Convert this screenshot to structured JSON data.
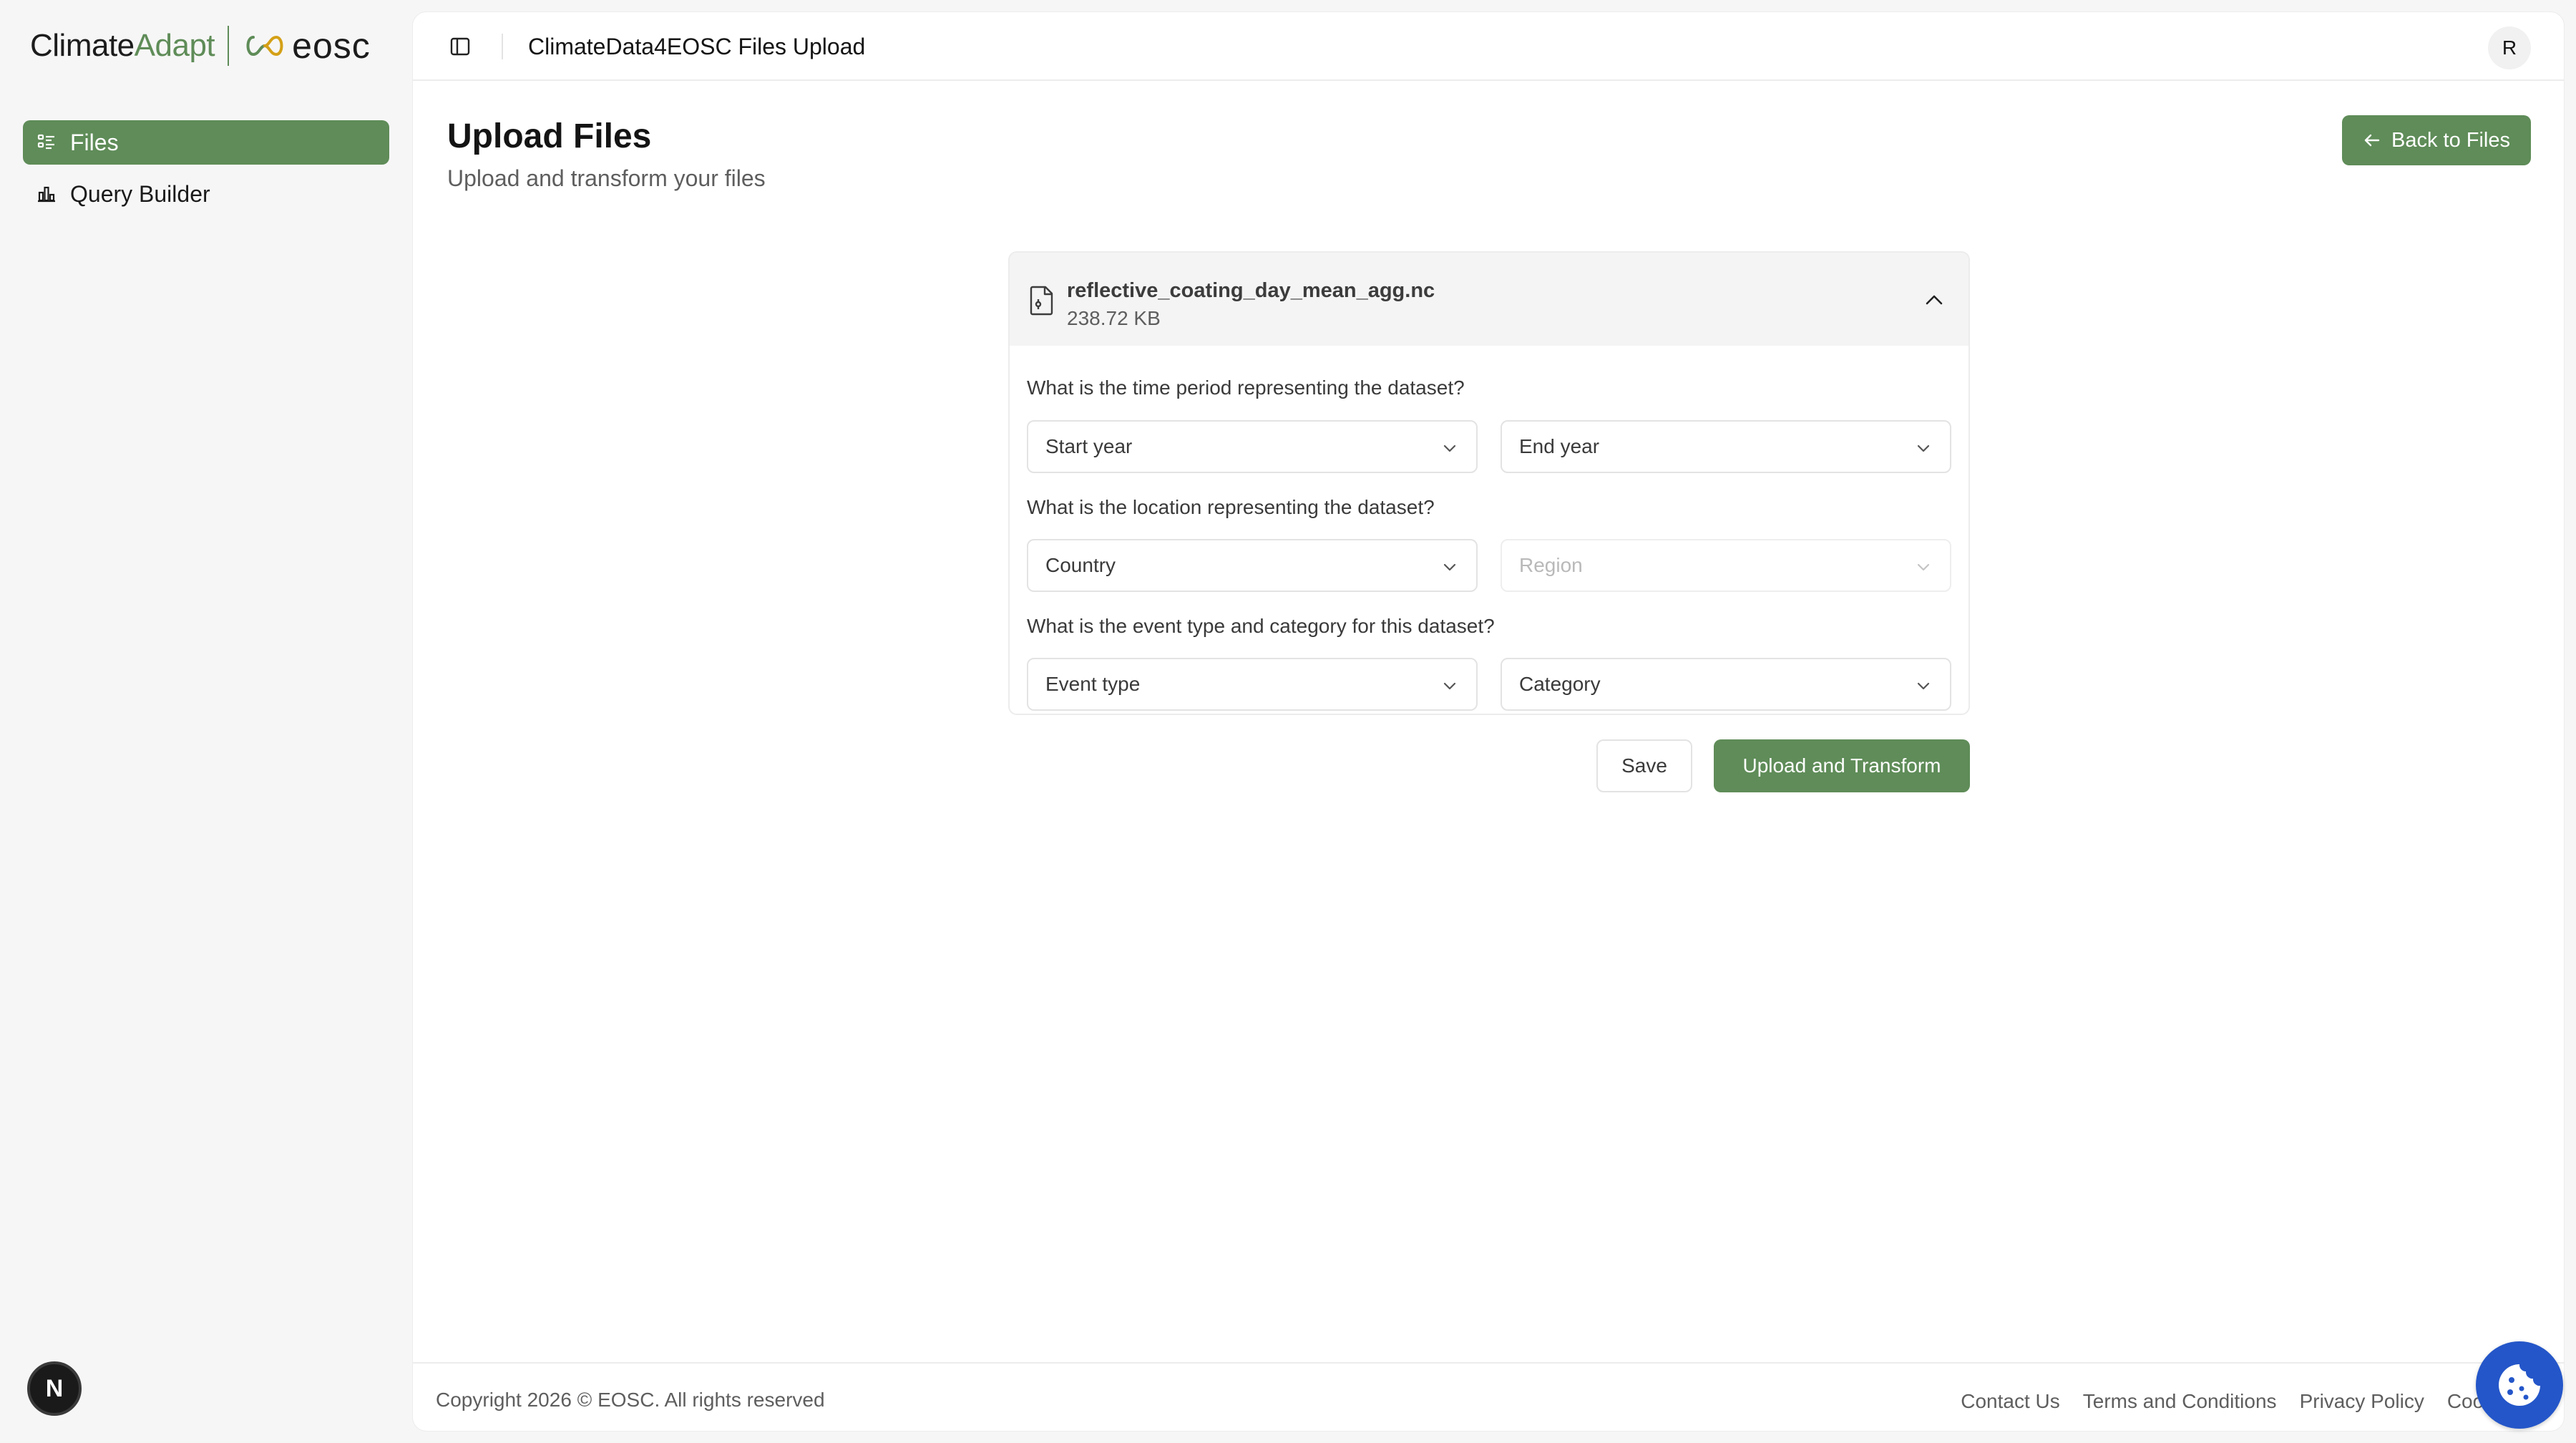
{
  "brand": {
    "climate": "Climate",
    "adapt": "Adapt",
    "eosc": "eosc"
  },
  "sidebar": {
    "items": [
      {
        "label": "Files",
        "icon": "list-icon",
        "active": true
      },
      {
        "label": "Query Builder",
        "icon": "chart-icon",
        "active": false
      }
    ]
  },
  "topbar": {
    "title": "ClimateData4EOSC Files Upload",
    "user_initial": "R"
  },
  "page": {
    "title": "Upload Files",
    "subtitle": "Upload and transform your files",
    "back_label": "Back to Files"
  },
  "file": {
    "name": "reflective_coating_day_mean_agg.nc",
    "size": "238.72 KB"
  },
  "form": {
    "q_time": "What is the time period representing the dataset?",
    "start_year": "Start year",
    "end_year": "End year",
    "q_location": "What is the location representing the dataset?",
    "country": "Country",
    "region": "Region",
    "q_event": "What is the event type and category for this dataset?",
    "event_type": "Event type",
    "category": "Category"
  },
  "actions": {
    "save": "Save",
    "upload": "Upload and Transform"
  },
  "footer": {
    "copyright": "Copyright 2026 © EOSC. All rights reserved",
    "links": [
      "Contact Us",
      "Terms and Conditions",
      "Privacy Policy",
      "Cookies"
    ]
  },
  "misc": {
    "next_badge": "N"
  },
  "colors": {
    "accent": "#5f8c58",
    "cookie": "#2456c9"
  }
}
